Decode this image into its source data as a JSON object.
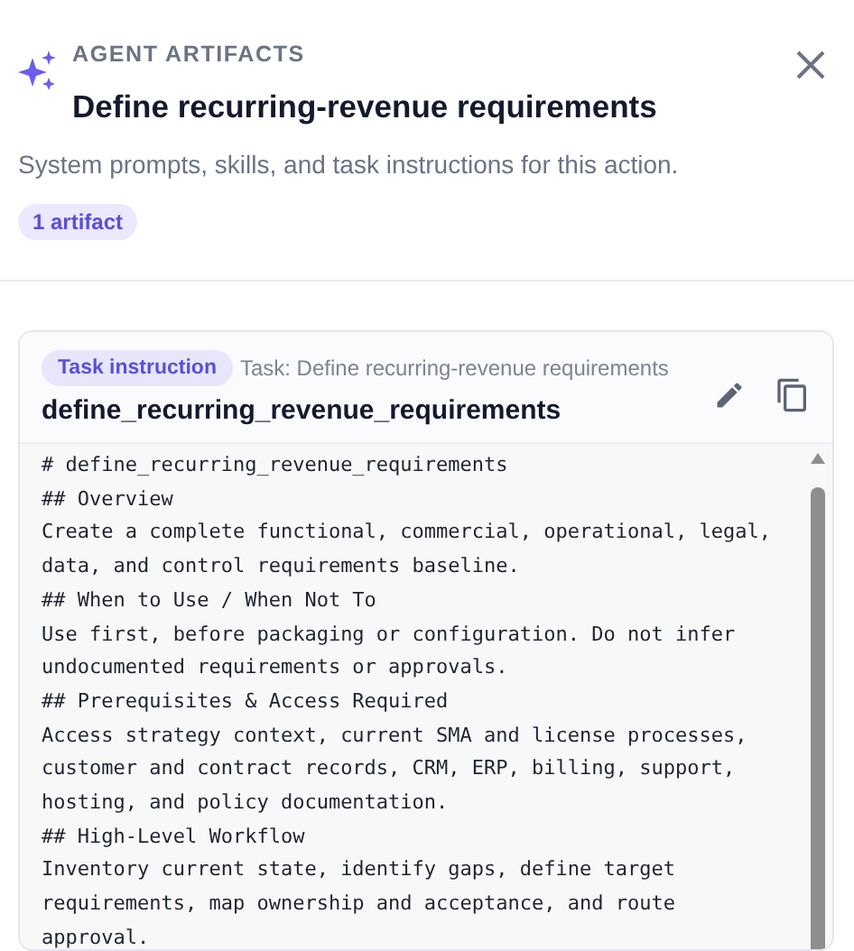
{
  "header": {
    "eyebrow": "AGENT ARTIFACTS",
    "title": "Define recurring-revenue requirements",
    "subtitle": "System prompts, skills, and task instructions for this action.",
    "count_badge": "1 artifact"
  },
  "artifacts": [
    {
      "kind": "task",
      "type_badge": "Task instruction",
      "meta": "Task: Define recurring-revenue requirements",
      "name": "define_recurring_revenue_requirements",
      "content_lines": [
        "# define_recurring_revenue_requirements",
        "## Overview",
        "Create a complete functional, commercial, operational, legal,",
        "data, and control requirements baseline.",
        "## When to Use / When Not To",
        "Use first, before packaging or configuration. Do not infer",
        "undocumented requirements or approvals.",
        "## Prerequisites & Access Required",
        "Access strategy context, current SMA and license processes,",
        "customer and contract records, CRM, ERP, billing, support,",
        "hosting, and policy documentation.",
        "## High-Level Workflow",
        "Inventory current state, identify gaps, define target",
        "requirements, map ownership and acceptance, and route",
        "approval."
      ]
    }
  ]
}
